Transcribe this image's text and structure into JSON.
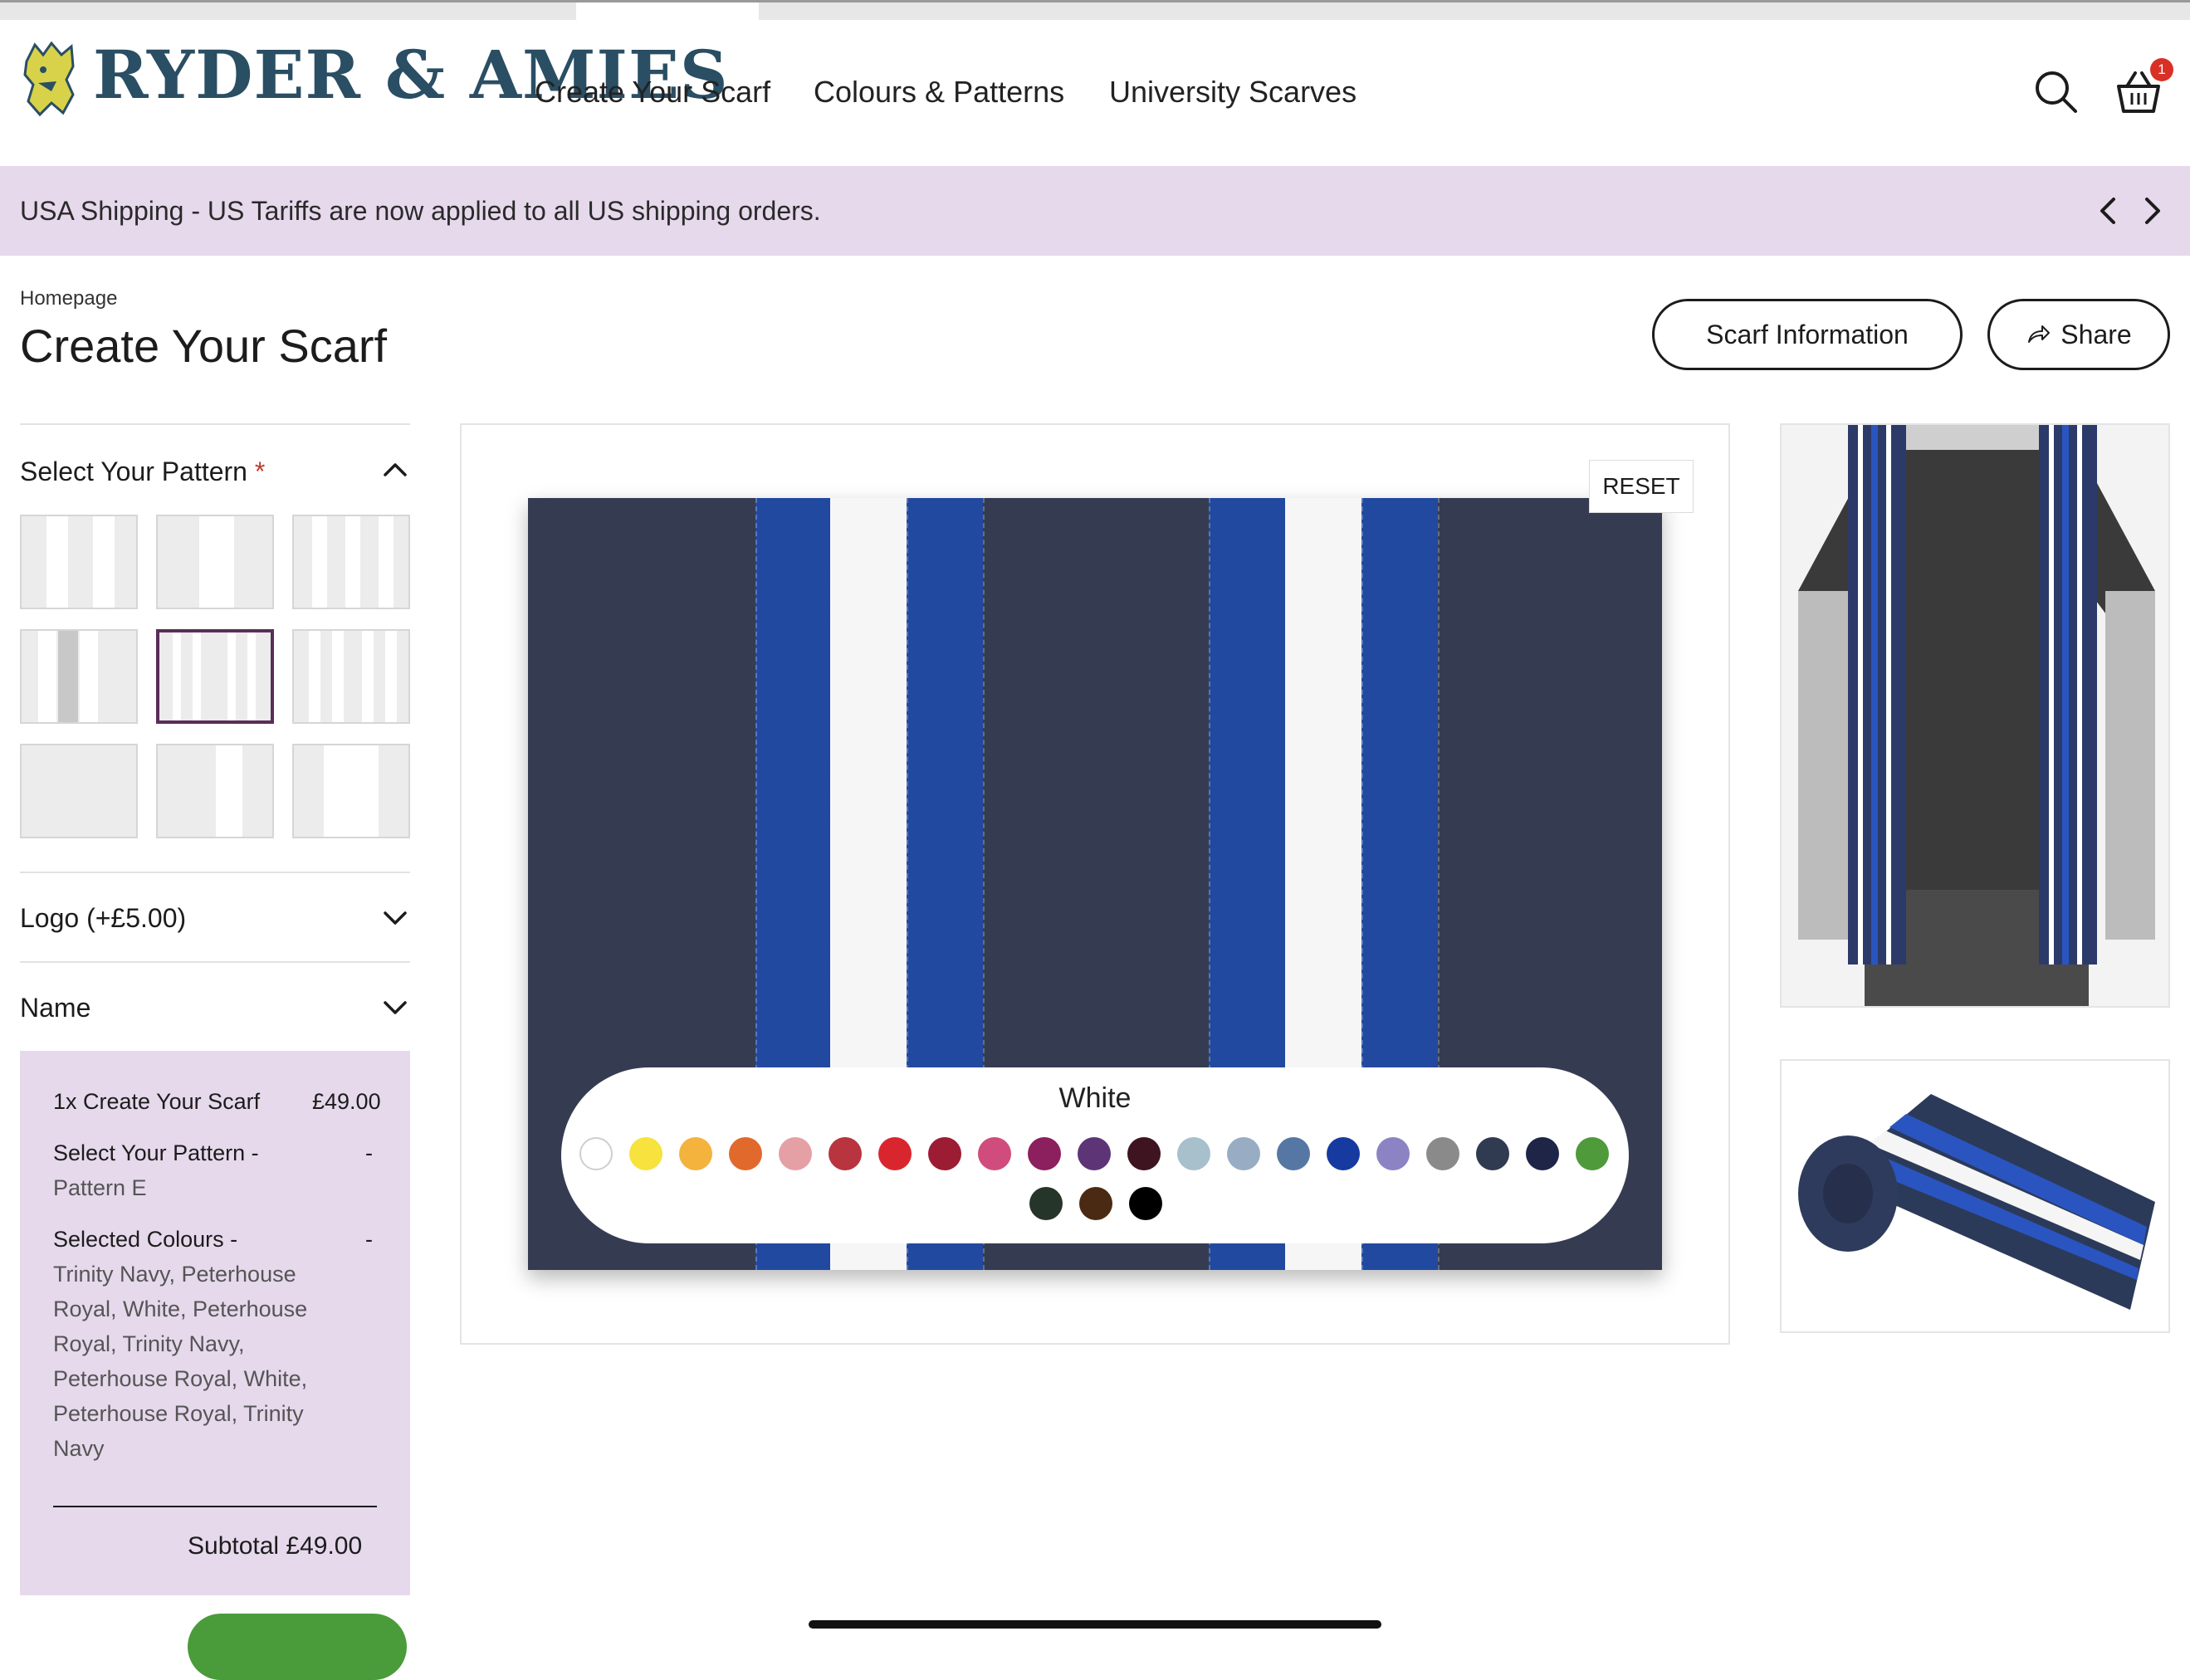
{
  "brand": {
    "name": "RYDER & AMIES"
  },
  "nav": {
    "items": [
      "Create Your Scarf",
      "Colours & Patterns",
      "University Scarves"
    ]
  },
  "cart": {
    "count": "1"
  },
  "announcement": {
    "text": "USA Shipping - US Tariffs are now applied to all US shipping orders."
  },
  "page": {
    "breadcrumb": "Homepage",
    "title": "Create Your Scarf"
  },
  "actions": {
    "info_label": "Scarf Information",
    "share_label": "Share"
  },
  "sidebar": {
    "pattern_title": "Select Your Pattern",
    "required_mark": "*",
    "selected_pattern_index": 4,
    "logo_title": "Logo (+£5.00)",
    "name_title": "Name"
  },
  "summary": {
    "item_label": "1x Create Your Scarf",
    "item_price": "£49.00",
    "pattern_label": "Select Your Pattern -",
    "pattern_dash": "-",
    "pattern_value": "Pattern E",
    "colours_label": "Selected Colours -",
    "colours_dash": "-",
    "colours_value": "Trinity Navy, Peterhouse Royal, White, Peterhouse Royal, Trinity Navy, Peterhouse Royal, White, Peterhouse Royal, Trinity Navy",
    "subtotal": "Subtotal £49.00"
  },
  "preview": {
    "reset_label": "RESET",
    "selected_colour_name": "White",
    "stripe_colours": [
      "#353c52",
      "#2249a0",
      "#f6f6f6",
      "#2249a0",
      "#353c52",
      "#2249a0",
      "#f6f6f6",
      "#2249a0",
      "#353c52"
    ]
  },
  "palette": {
    "swatches": [
      "#ffffff",
      "#f7e23e",
      "#f3b33d",
      "#e2692c",
      "#e5a0a6",
      "#b8343f",
      "#d9262e",
      "#9c1c33",
      "#d04c7c",
      "#8c1f5e",
      "#5d3576",
      "#3e1420",
      "#a8bfcc",
      "#98adc3",
      "#5677a3",
      "#173aa0",
      "#8c83c4",
      "#8a8a8a",
      "#303a50",
      "#1f2547",
      "#4f9a3b",
      "#253529",
      "#4a2a12",
      "#000000"
    ]
  },
  "colors": {
    "accent_purple": "#e6d9ec",
    "brand_teal": "#2a4e63",
    "cta_green": "#4a9b3a"
  }
}
